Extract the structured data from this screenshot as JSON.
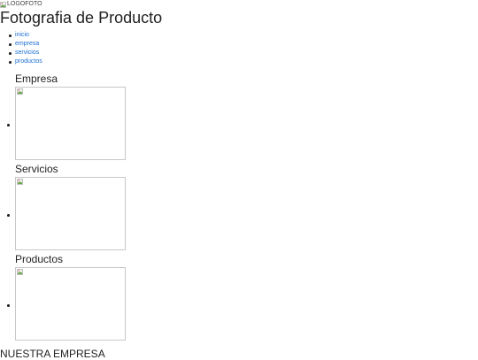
{
  "header": {
    "logo_alt": "LOGOFOTO",
    "title": "Fotografia de Producto"
  },
  "nav": {
    "items": [
      {
        "label": "inicio"
      },
      {
        "label": "empresa"
      },
      {
        "label": "servicios"
      },
      {
        "label": "productos"
      }
    ]
  },
  "sections": [
    {
      "title": "Empresa",
      "image": "broken-image-icon"
    },
    {
      "title": "Servicios",
      "image": "broken-image-icon"
    },
    {
      "title": "Productos",
      "image": "broken-image-icon"
    }
  ],
  "footer": {
    "heading": "NUESTRA EMPRESA"
  },
  "colors": {
    "link": "#1a6fd6",
    "text": "#222222",
    "image_border": "#c8c8c8"
  }
}
